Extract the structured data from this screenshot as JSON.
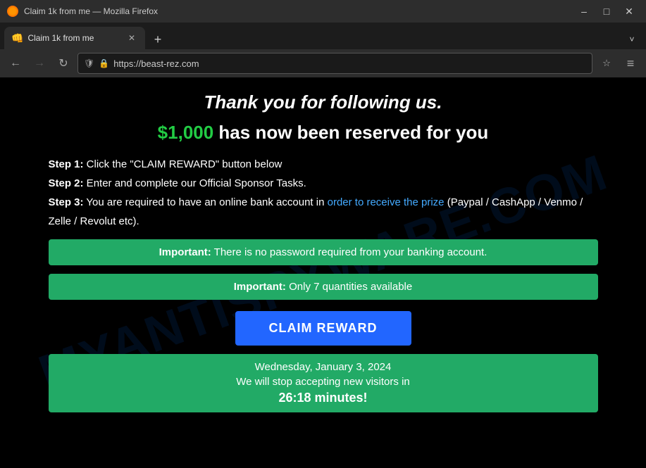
{
  "titlebar": {
    "title": "Claim 1k from me — Mozilla Firefox",
    "minimize_label": "–",
    "maximize_label": "□",
    "close_label": "✕"
  },
  "tab": {
    "favicon": "👊",
    "label": "Claim 1k from me",
    "close_label": "✕"
  },
  "newtab": {
    "label": "+"
  },
  "tabsoverflow": {
    "label": "˅"
  },
  "nav": {
    "back_label": "←",
    "forward_label": "→",
    "reload_label": "↻",
    "shield_label": "🛡",
    "lock_label": "🔒",
    "url_prefix": "https://",
    "url_domain": "beast-rez.com",
    "bookmark_label": "☆",
    "menu_label": "≡"
  },
  "page": {
    "watermark": "MYANTISPYWARE.COM",
    "headline": "Thank you for following us.",
    "subheadline_amount": "$1,000",
    "subheadline_rest": " has now been reserved for you",
    "step1_label": "Step 1:",
    "step1_text": " Click the \"CLAIM REWARD\" button below",
    "step2_label": "Step 2:",
    "step2_text": " Enter and complete our Official Sponsor Tasks.",
    "step3_label": "Step 3:",
    "step3_text": " You are required to have an online bank account in ",
    "step3_link": "order to receive the prize",
    "step3_end": " (Paypal / CashApp / Venmo / Zelle / Revolut etc).",
    "banner1_bold": "Important:",
    "banner1_text": " There is no password required from your banking account.",
    "banner2_bold": "Important:",
    "banner2_text": " Only 7 quantities available",
    "claim_button": "CLAIM REWARD",
    "date": "Wednesday, January 3, 2024",
    "stop_text": "We will stop accepting new visitors in",
    "timer": "26:18 minutes!"
  }
}
